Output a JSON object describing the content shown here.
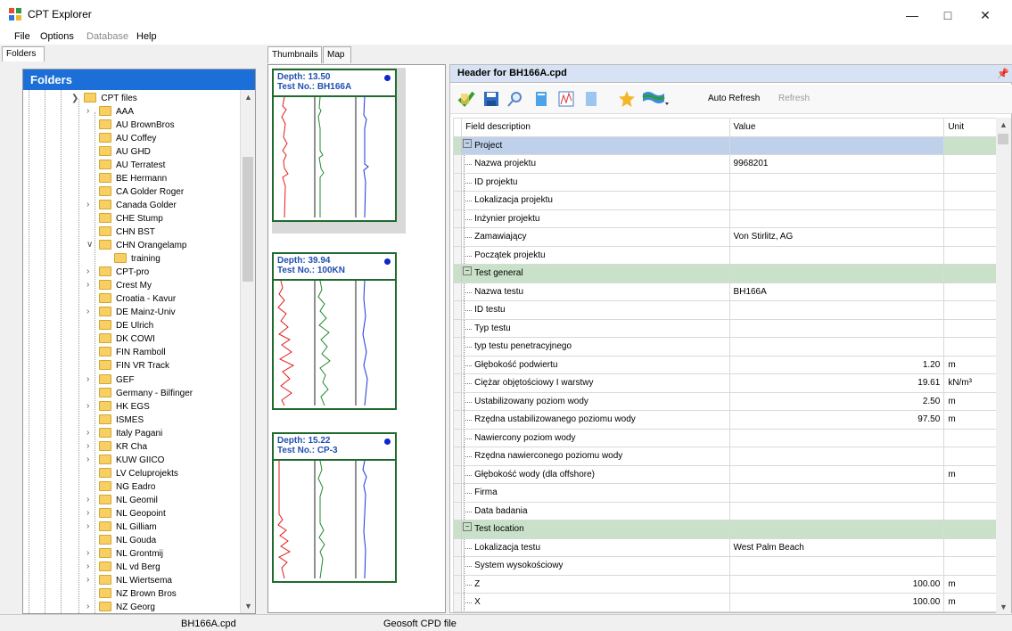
{
  "app": {
    "title": "CPT Explorer"
  },
  "window_controls": {
    "minimize": "—",
    "maximize": "□",
    "close": "✕"
  },
  "menu": [
    {
      "label": "File",
      "enabled": true
    },
    {
      "label": "Options",
      "enabled": true
    },
    {
      "label": "Database",
      "enabled": false
    },
    {
      "label": "Help",
      "enabled": true
    }
  ],
  "left_panel": {
    "tab": "Folders",
    "header": "Folders",
    "root": "CPT files",
    "items": [
      {
        "label": "AAA",
        "expandable": true
      },
      {
        "label": "AU BrownBros",
        "expandable": false
      },
      {
        "label": "AU Coffey",
        "expandable": false
      },
      {
        "label": "AU GHD",
        "expandable": false
      },
      {
        "label": "AU Terratest",
        "expandable": false
      },
      {
        "label": "BE Hermann",
        "expandable": false
      },
      {
        "label": "CA Golder Roger",
        "expandable": false
      },
      {
        "label": "Canada Golder",
        "expandable": true
      },
      {
        "label": "CHE Stump",
        "expandable": false
      },
      {
        "label": "CHN BST",
        "expandable": false
      },
      {
        "label": "CHN Orangelamp",
        "expandable": true,
        "expanded": true
      },
      {
        "label": "training",
        "expandable": false,
        "child": true
      },
      {
        "label": "CPT-pro",
        "expandable": true
      },
      {
        "label": "Crest My",
        "expandable": true
      },
      {
        "label": "Croatia - Kavur",
        "expandable": false
      },
      {
        "label": "DE Mainz-Univ",
        "expandable": true
      },
      {
        "label": "DE Ulrich",
        "expandable": false
      },
      {
        "label": "DK COWI",
        "expandable": false
      },
      {
        "label": "FIN Ramboll",
        "expandable": false
      },
      {
        "label": "FIN VR Track",
        "expandable": false
      },
      {
        "label": "GEF",
        "expandable": true
      },
      {
        "label": "Germany - Bilfinger",
        "expandable": false
      },
      {
        "label": "HK EGS",
        "expandable": true
      },
      {
        "label": "ISMES",
        "expandable": false
      },
      {
        "label": "Italy Pagani",
        "expandable": true
      },
      {
        "label": "KR Cha",
        "expandable": true
      },
      {
        "label": "KUW GIICO",
        "expandable": true
      },
      {
        "label": "LV Celuprojekts",
        "expandable": false
      },
      {
        "label": "NG Eadro",
        "expandable": false
      },
      {
        "label": "NL Geomil",
        "expandable": true
      },
      {
        "label": "NL Geopoint",
        "expandable": true
      },
      {
        "label": "NL Gilliam",
        "expandable": true
      },
      {
        "label": "NL Gouda",
        "expandable": false
      },
      {
        "label": "NL Grontmij",
        "expandable": true
      },
      {
        "label": "NL vd Berg",
        "expandable": true
      },
      {
        "label": "NL Wiertsema",
        "expandable": true
      },
      {
        "label": "NZ Brown Bros",
        "expandable": false
      },
      {
        "label": "NZ Georg",
        "expandable": true
      }
    ]
  },
  "middle_tabs": [
    "Thumbnails",
    "Map"
  ],
  "thumbnails": [
    {
      "depth": "Depth: 13.50",
      "test": "Test No.: BH166A"
    },
    {
      "depth": "Depth: 39.94",
      "test": "Test No.: 100KN"
    },
    {
      "depth": "Depth: 15.22",
      "test": "Test No.: CP-3"
    }
  ],
  "right_panel": {
    "title": "Header for BH166A.cpd",
    "toolbar": {
      "auto_refresh": "Auto Refresh",
      "refresh": "Refresh"
    },
    "columns": {
      "field": "Field description",
      "value": "Value",
      "unit": "Unit"
    },
    "rows": [
      {
        "type": "section",
        "field": "Project",
        "value": "",
        "unit": ""
      },
      {
        "type": "row",
        "field": "Nazwa projektu",
        "value": "9968201",
        "unit": "",
        "align": "left"
      },
      {
        "type": "row",
        "field": "ID projektu",
        "value": "",
        "unit": ""
      },
      {
        "type": "row",
        "field": "Lokalizacja projektu",
        "value": "",
        "unit": ""
      },
      {
        "type": "row",
        "field": "Inżynier projektu",
        "value": "",
        "unit": ""
      },
      {
        "type": "row",
        "field": "Zamawiający",
        "value": "Von Stirlitz, AG",
        "unit": "",
        "align": "left"
      },
      {
        "type": "row",
        "field": "Początek projektu",
        "value": "",
        "unit": ""
      },
      {
        "type": "section",
        "field": "Test general",
        "value": "",
        "unit": ""
      },
      {
        "type": "row",
        "field": "Nazwa testu",
        "value": "BH166A",
        "unit": "",
        "align": "left"
      },
      {
        "type": "row",
        "field": "ID testu",
        "value": "",
        "unit": ""
      },
      {
        "type": "row",
        "field": "Typ testu",
        "value": "",
        "unit": ""
      },
      {
        "type": "row",
        "field": "typ testu penetracyjnego",
        "value": "",
        "unit": ""
      },
      {
        "type": "row",
        "field": "Głębokość podwiertu",
        "value": "1.20",
        "unit": "m",
        "align": "right"
      },
      {
        "type": "row",
        "field": "Ciężar objętościowy I warstwy",
        "value": "19.61",
        "unit": "kN/m³",
        "align": "right"
      },
      {
        "type": "row",
        "field": "Ustabilizowany poziom wody",
        "value": "2.50",
        "unit": "m",
        "align": "right"
      },
      {
        "type": "row",
        "field": "Rzędna ustabilizowanego poziomu wody",
        "value": "97.50",
        "unit": "m",
        "align": "right"
      },
      {
        "type": "row",
        "field": "Nawiercony poziom wody",
        "value": "",
        "unit": ""
      },
      {
        "type": "row",
        "field": "Rzędna nawierconego poziomu wody",
        "value": "",
        "unit": ""
      },
      {
        "type": "row",
        "field": "Głębokość wody (dla offshore)",
        "value": "",
        "unit": "m"
      },
      {
        "type": "row",
        "field": "Firma",
        "value": "",
        "unit": ""
      },
      {
        "type": "row",
        "field": "Data badania",
        "value": "",
        "unit": ""
      },
      {
        "type": "section",
        "field": "Test location",
        "value": "",
        "unit": ""
      },
      {
        "type": "row",
        "field": "Lokalizacja testu",
        "value": "West Palm Beach",
        "unit": "",
        "align": "left"
      },
      {
        "type": "row",
        "field": "System wysokościowy",
        "value": "",
        "unit": ""
      },
      {
        "type": "row",
        "field": "Z",
        "value": "100.00",
        "unit": "m",
        "align": "right"
      },
      {
        "type": "row",
        "field": "X",
        "value": "100.00",
        "unit": "m",
        "align": "right"
      }
    ]
  },
  "status": {
    "file": "BH166A.cpd",
    "type": "Geosoft CPD file"
  },
  "colors": {
    "folders_header": "#1c6fd8",
    "section": "#c9e1c9",
    "thumb_border": "#1f6b2e",
    "thumb_text": "#1f4fb0"
  }
}
